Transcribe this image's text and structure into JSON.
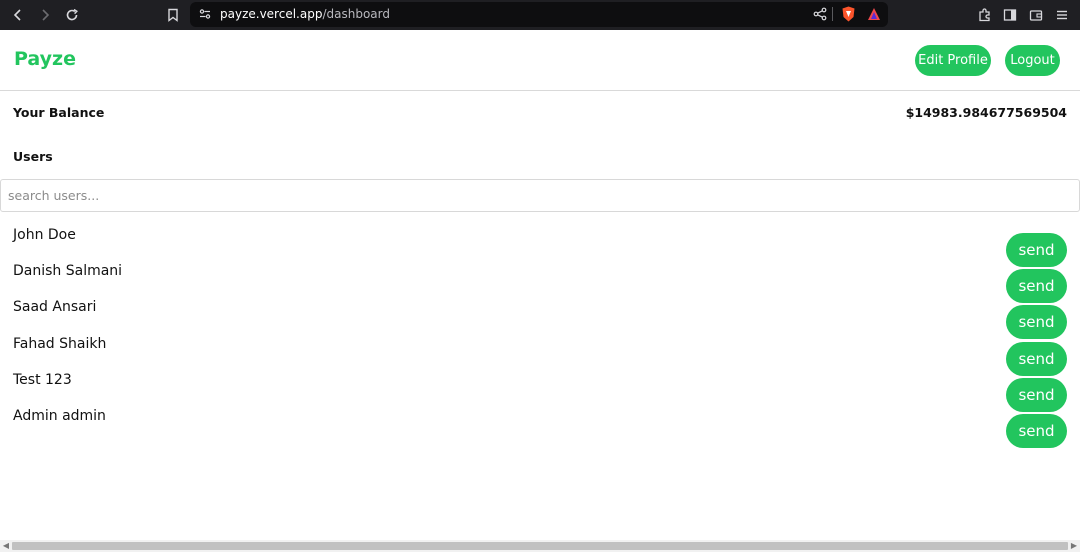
{
  "browser": {
    "url_host": "payze.vercel.app",
    "url_path": "/dashboard"
  },
  "header": {
    "brand": "Payze",
    "edit_profile_label": "Edit Profile",
    "logout_label": "Logout"
  },
  "balance": {
    "label": "Your Balance",
    "value": "$14983.984677569504"
  },
  "users": {
    "heading": "Users",
    "search_placeholder": "search users...",
    "send_label": "send",
    "list": [
      {
        "name": "John Doe"
      },
      {
        "name": "Danish Salmani"
      },
      {
        "name": "Saad Ansari"
      },
      {
        "name": "Fahad Shaikh"
      },
      {
        "name": "Test 123"
      },
      {
        "name": "Admin admin"
      }
    ]
  },
  "colors": {
    "accent": "#22c55e",
    "chrome_bg": "#1f1f23"
  }
}
